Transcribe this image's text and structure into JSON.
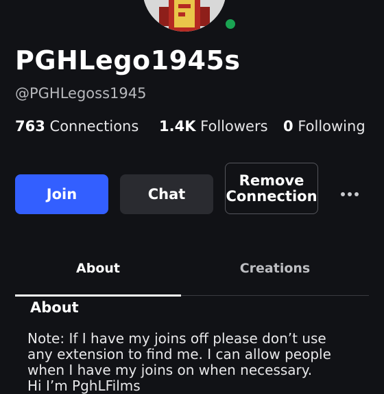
{
  "profile": {
    "display_name": "PGHLego1945s",
    "username": "@PGHLegoss1945",
    "online_status": "online"
  },
  "stats": {
    "connections_count": "763",
    "connections_label": "Connections",
    "followers_count": "1.4K",
    "followers_label": "Followers",
    "following_count": "0",
    "following_label": "Following"
  },
  "actions": {
    "join_label": "Join",
    "chat_label": "Chat",
    "remove_label": "Remove Connection",
    "more_icon": "ellipsis-icon"
  },
  "tabs": [
    {
      "label": "About",
      "active": true
    },
    {
      "label": "Creations",
      "active": false
    }
  ],
  "about": {
    "title": "About",
    "text": "Note: If I have my joins off please don’t use\nany extension to find me. I can allow people\nwhen I have my joins on when necessary.\nHi I’m PghLFilms"
  },
  "colors": {
    "background": "#111216",
    "join_button": "#335fff",
    "chat_button": "#2a2b30",
    "presence": "#1aa352"
  }
}
